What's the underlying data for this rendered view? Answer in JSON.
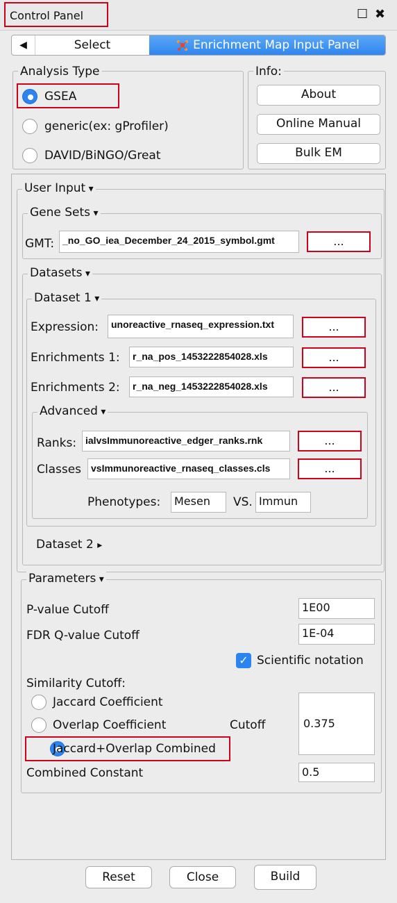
{
  "window": {
    "title": "Control Panel",
    "restore_icon": "☐",
    "close_icon": "✖"
  },
  "tabs": {
    "back_icon": "◀",
    "select_label": "Select",
    "em_label": "Enrichment Map Input Panel",
    "em_icon": "network-icon"
  },
  "analysis_type": {
    "legend": "Analysis Type",
    "options": [
      "GSEA",
      "generic(ex: gProfiler)",
      "DAVID/BiNGO/Great"
    ],
    "selected": "GSEA"
  },
  "info": {
    "legend": "Info:",
    "about": "About",
    "manual": "Online Manual",
    "bulk": "Bulk EM"
  },
  "user_input": {
    "legend": "User Input",
    "gene_sets": {
      "legend": "Gene Sets",
      "gmt_label": "GMT:",
      "gmt_value": "_no_GO_iea_December_24_2015_symbol.gmt",
      "browse": "..."
    },
    "datasets": {
      "legend": "Datasets",
      "dataset1": {
        "legend": "Dataset 1",
        "expression_label": "Expression:",
        "expression_value": "unoreactive_rnaseq_expression.txt",
        "enrich1_label": "Enrichments 1:",
        "enrich1_value": "r_na_pos_1453222854028.xls",
        "enrich2_label": "Enrichments 2:",
        "enrich2_value": "r_na_neg_1453222854028.xls",
        "browse": "...",
        "advanced": {
          "legend": "Advanced",
          "ranks_label": "Ranks:",
          "ranks_value": "ialvsImmunoreactive_edger_ranks.rnk",
          "classes_label": "Classes",
          "classes_value": "vsImmunoreactive_rnaseq_classes.cls",
          "phenotypes_label": "Phenotypes:",
          "pheno1": "Mesen",
          "vs_label": "VS.",
          "pheno2": "Immun"
        }
      },
      "dataset2_label": "Dataset 2",
      "dataset2_icon": "▸"
    }
  },
  "parameters": {
    "legend": "Parameters",
    "pvalue_label": "P-value Cutoff",
    "pvalue": "1E00",
    "fdr_label": "FDR Q-value Cutoff",
    "fdr": "1E-04",
    "scientific_label": "Scientific notation",
    "scientific_checked": true,
    "similarity_label": "Similarity Cutoff:",
    "similarity_options": [
      "Jaccard Coefficient",
      "Overlap Coefficient",
      "Jaccard+Overlap Combined"
    ],
    "similarity_selected": "Jaccard+Overlap Combined",
    "cutoff_label": "Cutoff",
    "cutoff_value": "0.375",
    "combined_label": "Combined Constant",
    "combined_value": "0.5"
  },
  "actions": {
    "reset": "Reset",
    "close": "Close",
    "build": "Build"
  },
  "colors": {
    "accent": "#2b84f0",
    "highlight": "#d0021b"
  }
}
